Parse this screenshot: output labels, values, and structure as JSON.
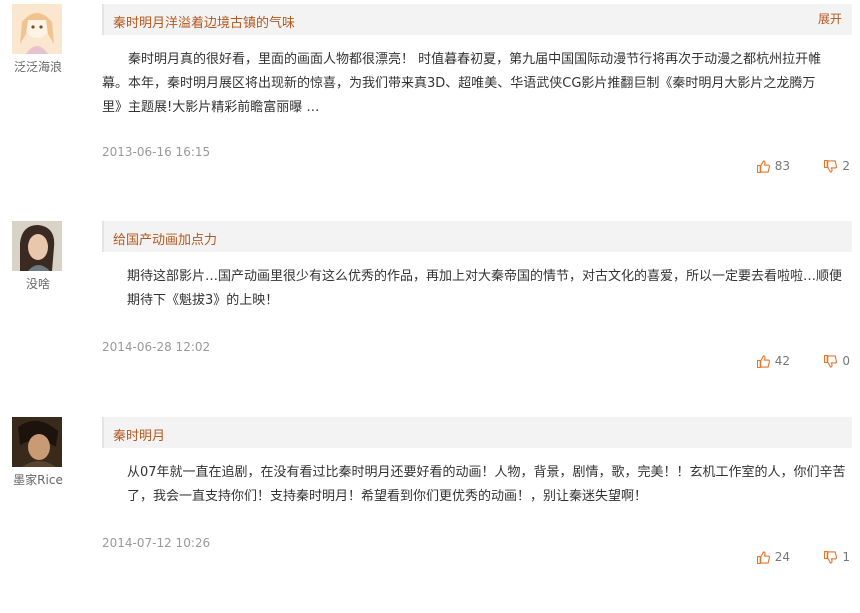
{
  "reviews": [
    {
      "username": "泛泛海浪",
      "title": "秦时明月洋溢着边境古镇的气味",
      "expand_label": "展开",
      "body": "　　秦时明月真的很好看，里面的画面人物都很漂亮！ 时值暮春初夏，第九届中国国际动漫节行将再次于动漫之都杭州拉开帷幕。本年，秦时明月展区将出现新的惊喜，为我们带来真3D、超唯美、华语武侠CG影片推翻巨制《秦时明月大影片之龙腾万里》主题展!大影片精彩前瞻富丽曝 …",
      "date": "2013-06-16 16:15",
      "up": "83",
      "down": "2",
      "avatar_color": "#f3d7b5"
    },
    {
      "username": "没啥",
      "title": "给国产动画加点力",
      "body": "期待这部影片…国产动画里很少有这么优秀的作品，再加上对大秦帝国的情节，对古文化的喜爱，所以一定要去看啦啦…顺便期待下《魁拔3》的上映！",
      "date": "2014-06-28 12:02",
      "up": "42",
      "down": "0",
      "avatar_color": "#8a6a55"
    },
    {
      "username": "墨家Rice",
      "title": "秦时明月",
      "body": "从07年就一直在追剧，在没有看过比秦时明月还要好看的动画！人物，背景，剧情，歌，完美！！玄机工作室的人，你们辛苦了，我会一直支持你们！支持秦时明月！希望看到你们更优秀的动画！，别让秦迷失望啊！",
      "date": "2014-07-12 10:26",
      "up": "24",
      "down": "1",
      "avatar_color": "#6b4a2e"
    }
  ],
  "icons": {
    "up": "thumbs-up-icon",
    "down": "thumbs-down-icon",
    "accent": "#e8742a"
  }
}
